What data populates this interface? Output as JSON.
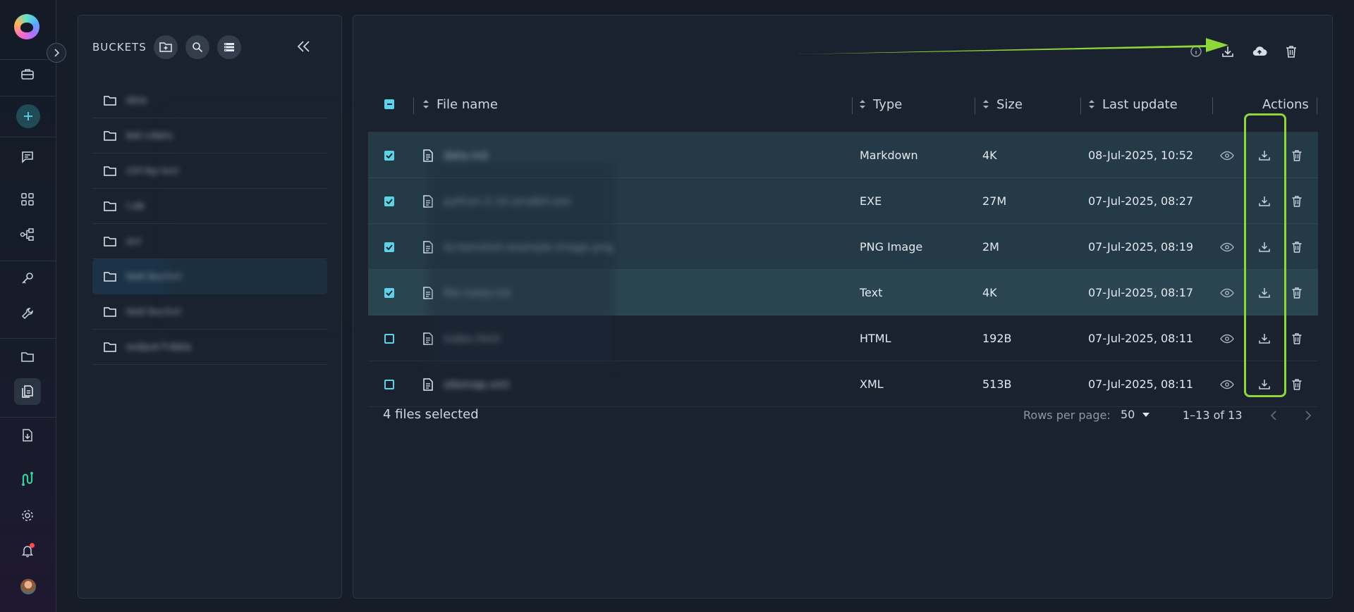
{
  "buckets": {
    "title": "BUCKETS",
    "items": [
      {
        "name": "ekio"
      },
      {
        "name": "ket-cdata"
      },
      {
        "name": "ctrl-by-last"
      },
      {
        "name": "l.ob"
      },
      {
        "name": "ocr"
      },
      {
        "name": "test-bucket"
      },
      {
        "name": "test-bucket"
      },
      {
        "name": "output-f-data"
      }
    ]
  },
  "table": {
    "columns": {
      "name": "File name",
      "type": "Type",
      "size": "Size",
      "updated": "Last update",
      "actions": "Actions"
    },
    "rows": [
      {
        "name": "data.md",
        "type": "Markdown",
        "size": "4K",
        "updated": "08-Jul-2025, 10:52",
        "checked": true,
        "preview": true
      },
      {
        "name": "python-3.10-amd64.exe",
        "type": "EXE",
        "size": "27M",
        "updated": "07-Jul-2025, 08:27",
        "checked": true,
        "preview": false
      },
      {
        "name": "Screenshot-example-image.png",
        "type": "PNG Image",
        "size": "2M",
        "updated": "07-Jul-2025, 08:19",
        "checked": true,
        "preview": true
      },
      {
        "name": "file-notes.txt",
        "type": "Text",
        "size": "4K",
        "updated": "07-Jul-2025, 08:17",
        "checked": true,
        "preview": true
      },
      {
        "name": "index.html",
        "type": "HTML",
        "size": "192B",
        "updated": "07-Jul-2025, 08:11",
        "checked": false,
        "preview": true
      },
      {
        "name": "sitemap.xml",
        "type": "XML",
        "size": "513B",
        "updated": "07-Jul-2025, 08:11",
        "checked": false,
        "preview": true
      }
    ]
  },
  "footer": {
    "selected": "4 files selected",
    "rows_per_page_label": "Rows per page:",
    "rows_per_page_value": "50",
    "range": "1–13 of 13"
  },
  "colors": {
    "accent": "#5cd3e8",
    "annotation": "#8fd63a"
  }
}
